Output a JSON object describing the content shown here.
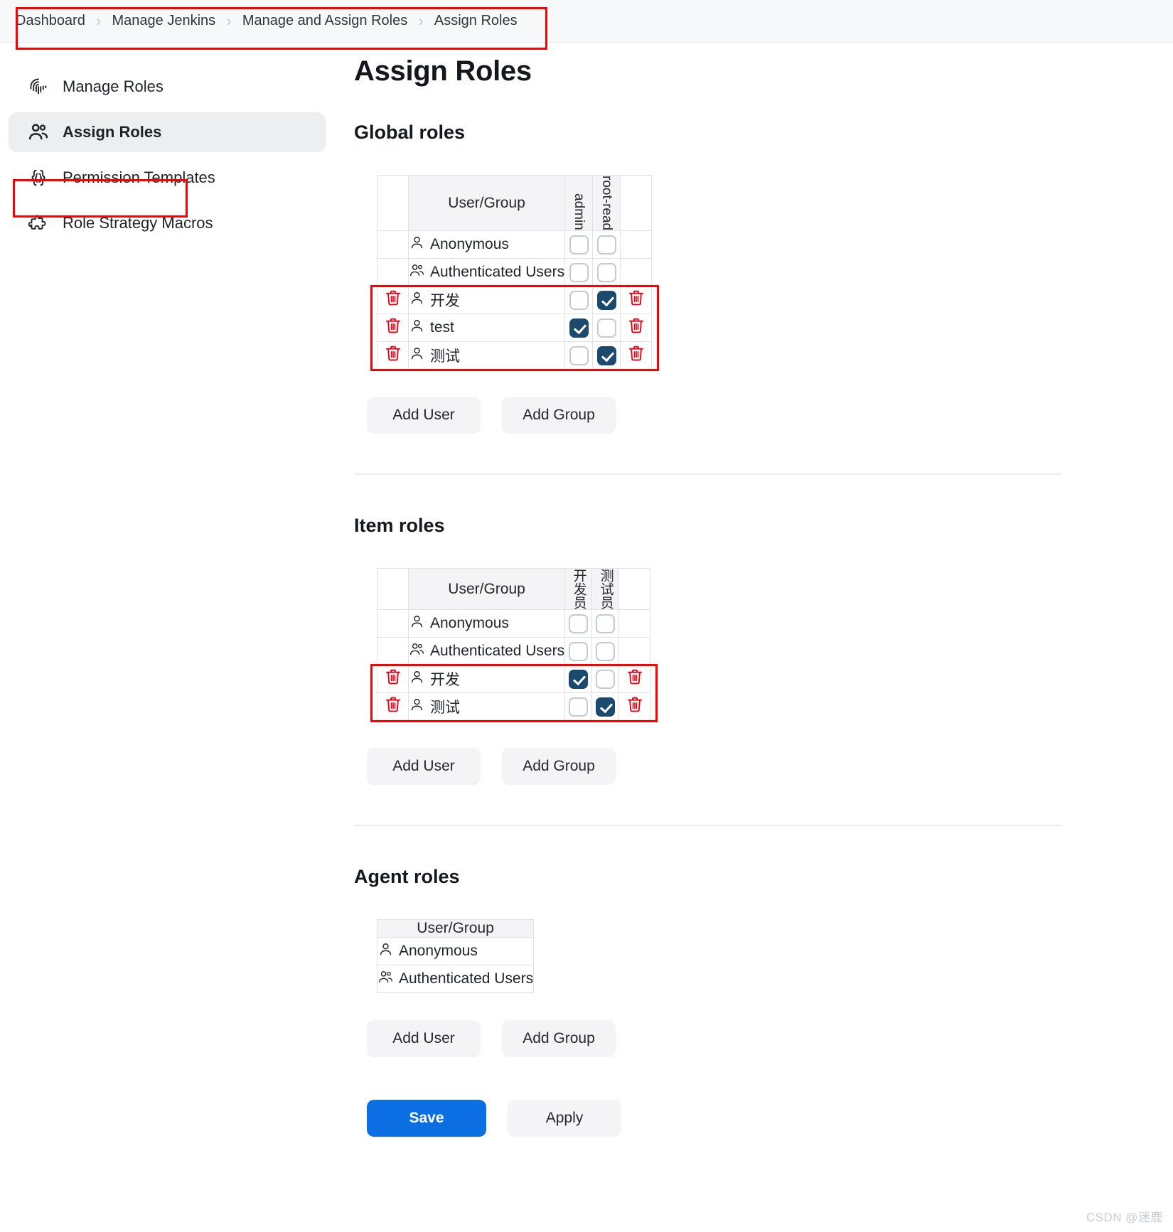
{
  "breadcrumb": {
    "items": [
      "Dashboard",
      "Manage Jenkins",
      "Manage and Assign Roles",
      "Assign Roles"
    ],
    "separator": "›"
  },
  "sidebar": {
    "items": [
      {
        "label": "Manage Roles",
        "icon": "fingerprint-icon",
        "active": false
      },
      {
        "label": "Assign Roles",
        "icon": "people-icon",
        "active": true
      },
      {
        "label": "Permission Templates",
        "icon": "braces-icon",
        "active": false
      },
      {
        "label": "Role Strategy Macros",
        "icon": "puzzle-icon",
        "active": false
      }
    ]
  },
  "main": {
    "title": "Assign Roles",
    "sections": [
      {
        "id": "global",
        "title": "Global roles",
        "user_group_header": "User/Group",
        "role_columns": [
          "admin",
          "root-read"
        ],
        "role_columns_cjk": false,
        "rows": [
          {
            "name": "Anonymous",
            "icon": "user-icon",
            "removable": false,
            "checks": [
              false,
              false
            ]
          },
          {
            "name": "Authenticated Users",
            "icon": "users-icon",
            "removable": false,
            "checks": [
              false,
              false
            ]
          },
          {
            "name": "开发",
            "icon": "user-icon",
            "removable": true,
            "checks": [
              false,
              true
            ]
          },
          {
            "name": "test",
            "icon": "user-icon",
            "removable": true,
            "checks": [
              true,
              false
            ]
          },
          {
            "name": "测试",
            "icon": "user-icon",
            "removable": true,
            "checks": [
              false,
              true
            ]
          }
        ],
        "add_user_label": "Add User",
        "add_group_label": "Add Group"
      },
      {
        "id": "item",
        "title": "Item roles",
        "user_group_header": "User/Group",
        "role_columns": [
          "开发员",
          "测试员"
        ],
        "role_columns_cjk": true,
        "rows": [
          {
            "name": "Anonymous",
            "icon": "user-icon",
            "removable": false,
            "checks": [
              false,
              false
            ]
          },
          {
            "name": "Authenticated Users",
            "icon": "users-icon",
            "removable": false,
            "checks": [
              false,
              false
            ]
          },
          {
            "name": "开发",
            "icon": "user-icon",
            "removable": true,
            "checks": [
              true,
              false
            ]
          },
          {
            "name": "测试",
            "icon": "user-icon",
            "removable": true,
            "checks": [
              false,
              true
            ]
          }
        ],
        "add_user_label": "Add User",
        "add_group_label": "Add Group"
      },
      {
        "id": "agent",
        "title": "Agent roles",
        "user_group_header": "User/Group",
        "role_columns": [],
        "role_columns_cjk": false,
        "rows": [
          {
            "name": "Anonymous",
            "icon": "user-icon",
            "removable": false,
            "checks": []
          },
          {
            "name": "Authenticated Users",
            "icon": "users-icon",
            "removable": false,
            "checks": []
          }
        ],
        "add_user_label": "Add User",
        "add_group_label": "Add Group"
      }
    ],
    "save_label": "Save",
    "apply_label": "Apply"
  },
  "colors": {
    "checkbox_checked": "#1c4a6e",
    "save_button": "#0b6fe3",
    "highlight_outline": "#ff0000",
    "trash_icon": "#e60012"
  },
  "watermark": "CSDN @迷鹿"
}
